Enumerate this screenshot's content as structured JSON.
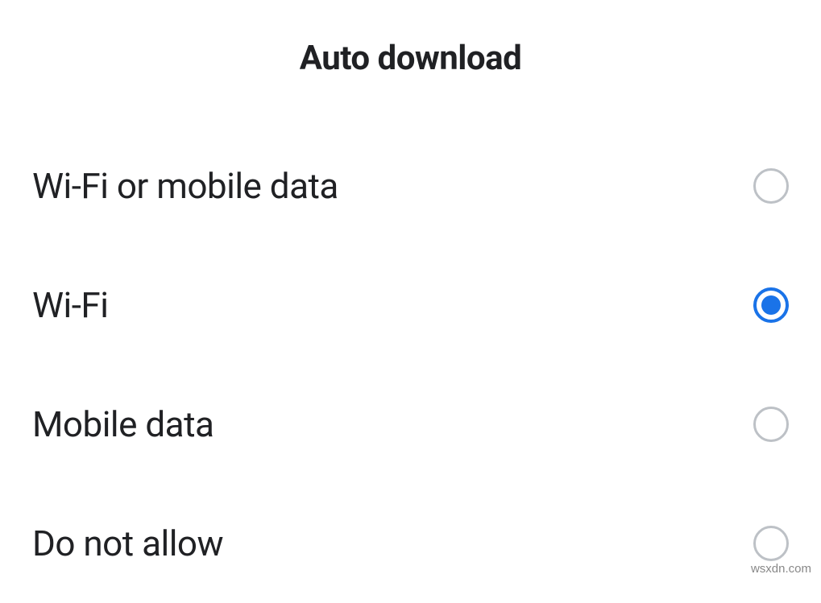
{
  "title": "Auto download",
  "options": [
    {
      "label": "Wi-Fi or mobile data",
      "selected": false
    },
    {
      "label": "Wi-Fi",
      "selected": true
    },
    {
      "label": "Mobile data",
      "selected": false
    },
    {
      "label": "Do not allow",
      "selected": false
    }
  ],
  "watermark": "wsxdn.com"
}
